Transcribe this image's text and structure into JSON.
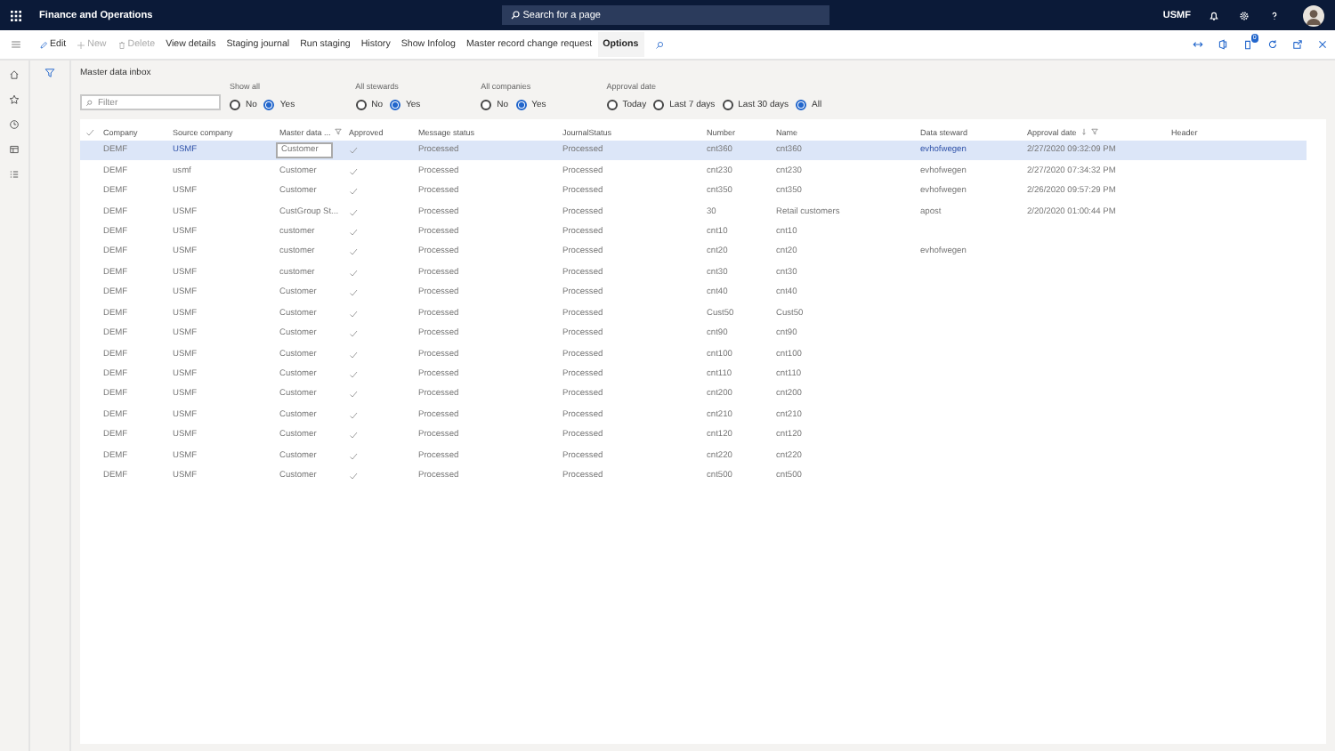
{
  "app": {
    "title": "Finance and Operations",
    "search_placeholder": "Search for a page",
    "company": "USMF"
  },
  "actions": [
    {
      "label": "Edit",
      "disabled": false,
      "bold": false
    },
    {
      "label": "New",
      "disabled": true,
      "bold": false
    },
    {
      "label": "Delete",
      "disabled": true,
      "bold": false
    },
    {
      "label": "View details",
      "disabled": false,
      "bold": false
    },
    {
      "label": "Staging journal",
      "disabled": false,
      "bold": false
    },
    {
      "label": "Run staging",
      "disabled": false,
      "bold": false
    },
    {
      "label": "History",
      "disabled": false,
      "bold": false
    },
    {
      "label": "Show Infolog",
      "disabled": false,
      "bold": false
    },
    {
      "label": "Master record change request",
      "disabled": false,
      "bold": false
    },
    {
      "label": "Options",
      "disabled": false,
      "bold": true
    }
  ],
  "notification_badge": "0",
  "page_title": "Master data inbox",
  "filter": {
    "placeholder": "Filter"
  },
  "radio_groups": [
    {
      "label": "Show all",
      "options": [
        {
          "label": "No",
          "selected": false
        },
        {
          "label": "Yes",
          "selected": true
        }
      ]
    },
    {
      "label": "All stewards",
      "options": [
        {
          "label": "No",
          "selected": false
        },
        {
          "label": "Yes",
          "selected": true
        }
      ]
    },
    {
      "label": "All companies",
      "options": [
        {
          "label": "No",
          "selected": false
        },
        {
          "label": "Yes",
          "selected": true
        }
      ]
    },
    {
      "label": "Approval date",
      "options": [
        {
          "label": "Today",
          "selected": false
        },
        {
          "label": "Last 7 days",
          "selected": false
        },
        {
          "label": "Last 30 days",
          "selected": false
        },
        {
          "label": "All",
          "selected": true
        }
      ]
    }
  ],
  "table": {
    "columns": [
      {
        "label": "Company",
        "filter": false,
        "sort": false
      },
      {
        "label": "Source company",
        "filter": false,
        "sort": false
      },
      {
        "label": "Master data ...",
        "filter": true,
        "sort": false
      },
      {
        "label": "Approved",
        "filter": false,
        "sort": false
      },
      {
        "label": "Message status",
        "filter": false,
        "sort": false
      },
      {
        "label": "JournalStatus",
        "filter": false,
        "sort": false
      },
      {
        "label": "Number",
        "filter": false,
        "sort": false
      },
      {
        "label": "Name",
        "filter": false,
        "sort": false
      },
      {
        "label": "Data steward",
        "filter": false,
        "sort": false
      },
      {
        "label": "Approval date",
        "filter": true,
        "sort": true
      },
      {
        "label": "Header",
        "filter": false,
        "sort": false
      }
    ],
    "rows": [
      {
        "selected": true,
        "company": "DEMF",
        "source": "USMF",
        "master": "Customer",
        "approved": true,
        "message": "Processed",
        "journal": "Processed",
        "number": "cnt360",
        "name": "cnt360",
        "steward": "evhofwegen",
        "date": "2/27/2020 09:32:09 PM"
      },
      {
        "selected": false,
        "company": "DEMF",
        "source": "usmf",
        "master": "Customer",
        "approved": true,
        "message": "Processed",
        "journal": "Processed",
        "number": "cnt230",
        "name": "cnt230",
        "steward": "evhofwegen",
        "date": "2/27/2020 07:34:32 PM"
      },
      {
        "selected": false,
        "company": "DEMF",
        "source": "USMF",
        "master": "Customer",
        "approved": true,
        "message": "Processed",
        "journal": "Processed",
        "number": "cnt350",
        "name": "cnt350",
        "steward": "evhofwegen",
        "date": "2/26/2020 09:57:29 PM"
      },
      {
        "selected": false,
        "company": "DEMF",
        "source": "USMF",
        "master": "CustGroup St...",
        "approved": true,
        "message": "Processed",
        "journal": "Processed",
        "number": "30",
        "name": "Retail customers",
        "steward": "apost",
        "date": "2/20/2020 01:00:44 PM"
      },
      {
        "selected": false,
        "company": "DEMF",
        "source": "USMF",
        "master": "customer",
        "approved": true,
        "message": "Processed",
        "journal": "Processed",
        "number": "cnt10",
        "name": "cnt10"
      },
      {
        "selected": false,
        "company": "DEMF",
        "source": "USMF",
        "master": "customer",
        "approved": true,
        "message": "Processed",
        "journal": "Processed",
        "number": "cnt20",
        "name": "cnt20",
        "steward": "evhofwegen"
      },
      {
        "selected": false,
        "company": "DEMF",
        "source": "USMF",
        "master": "customer",
        "approved": true,
        "message": "Processed",
        "journal": "Processed",
        "number": "cnt30",
        "name": "cnt30"
      },
      {
        "selected": false,
        "company": "DEMF",
        "source": "USMF",
        "master": "Customer",
        "approved": true,
        "message": "Processed",
        "journal": "Processed",
        "number": "cnt40",
        "name": "cnt40"
      },
      {
        "selected": false,
        "company": "DEMF",
        "source": "USMF",
        "master": "Customer",
        "approved": true,
        "message": "Processed",
        "journal": "Processed",
        "number": "Cust50",
        "name": "Cust50"
      },
      {
        "selected": false,
        "company": "DEMF",
        "source": "USMF",
        "master": "Customer",
        "approved": true,
        "message": "Processed",
        "journal": "Processed",
        "number": "cnt90",
        "name": "cnt90"
      },
      {
        "selected": false,
        "company": "DEMF",
        "source": "USMF",
        "master": "Customer",
        "approved": true,
        "message": "Processed",
        "journal": "Processed",
        "number": "cnt100",
        "name": "cnt100"
      },
      {
        "selected": false,
        "company": "DEMF",
        "source": "USMF",
        "master": "Customer",
        "approved": true,
        "message": "Processed",
        "journal": "Processed",
        "number": "cnt110",
        "name": "cnt110"
      },
      {
        "selected": false,
        "company": "DEMF",
        "source": "USMF",
        "master": "Customer",
        "approved": true,
        "message": "Processed",
        "journal": "Processed",
        "number": "cnt200",
        "name": "cnt200"
      },
      {
        "selected": false,
        "company": "DEMF",
        "source": "USMF",
        "master": "Customer",
        "approved": true,
        "message": "Processed",
        "journal": "Processed",
        "number": "cnt210",
        "name": "cnt210"
      },
      {
        "selected": false,
        "company": "DEMF",
        "source": "USMF",
        "master": "Customer",
        "approved": true,
        "message": "Processed",
        "journal": "Processed",
        "number": "cnt120",
        "name": "cnt120"
      },
      {
        "selected": false,
        "company": "DEMF",
        "source": "USMF",
        "master": "Customer",
        "approved": true,
        "message": "Processed",
        "journal": "Processed",
        "number": "cnt220",
        "name": "cnt220"
      },
      {
        "selected": false,
        "company": "DEMF",
        "source": "USMF",
        "master": "Customer",
        "approved": true,
        "message": "Processed",
        "journal": "Processed",
        "number": "cnt500",
        "name": "cnt500"
      }
    ]
  }
}
